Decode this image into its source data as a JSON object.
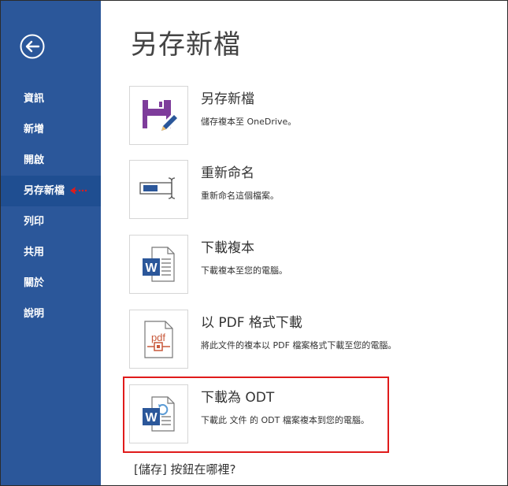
{
  "sidebar": {
    "back_icon": "back-arrow-icon",
    "items": [
      {
        "label": "資訊"
      },
      {
        "label": "新增"
      },
      {
        "label": "開啟"
      },
      {
        "label": "另存新檔",
        "active": true
      },
      {
        "label": "列印"
      },
      {
        "label": "共用"
      },
      {
        "label": "關於"
      },
      {
        "label": "說明"
      }
    ]
  },
  "main": {
    "title": "另存新檔",
    "options": [
      {
        "icon": "save-edit-icon",
        "title": "另存新檔",
        "desc": "儲存複本至 OneDrive。"
      },
      {
        "icon": "rename-icon",
        "title": "重新命名",
        "desc": "重新命名這個檔案。"
      },
      {
        "icon": "word-document-icon",
        "title": "下載複本",
        "desc": "下載複本至您的電腦。"
      },
      {
        "icon": "pdf-document-icon",
        "title": "以 PDF 格式下載",
        "desc": "將此文件的複本以 PDF 檔案格式下載至您的電腦。"
      },
      {
        "icon": "word-odt-icon",
        "title": "下載為 ODT",
        "desc": "下載此 文件 的 ODT 檔案複本到您的電腦。"
      }
    ],
    "where_link": "[儲存] 按鈕在哪裡?"
  },
  "colors": {
    "sidebar_bg": "#2b579a",
    "sidebar_active": "#1f4e91",
    "highlight_border": "#e01b1b",
    "purple_icon": "#7e3c9b",
    "word_blue": "#2b579a",
    "pdf_orange": "#c8593b"
  }
}
